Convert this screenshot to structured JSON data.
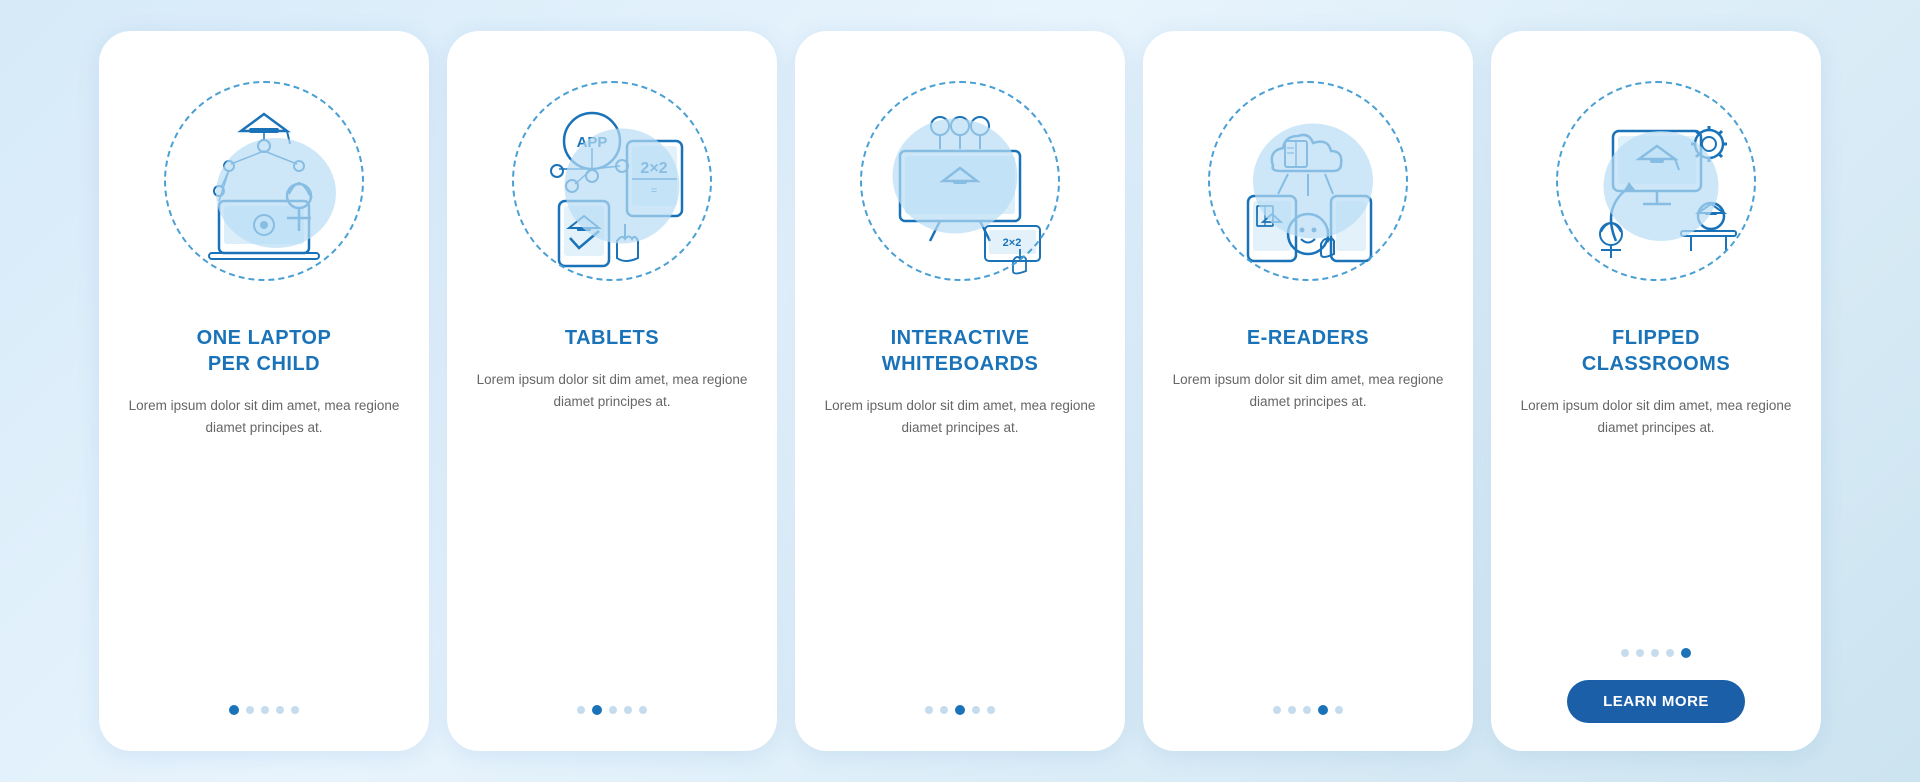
{
  "cards": [
    {
      "id": "laptop-per-child",
      "title": "ONE LAPTOP\nPER CHILD",
      "description": "Lorem ipsum dolor sit dim amet, mea regione diamet principes at.",
      "dots": [
        1,
        2,
        3,
        4,
        5
      ],
      "active_dot": 1,
      "has_button": false,
      "button_label": ""
    },
    {
      "id": "tablets",
      "title": "TABLETS",
      "description": "Lorem ipsum dolor sit dim amet, mea regione diamet principes at.",
      "dots": [
        1,
        2,
        3,
        4,
        5
      ],
      "active_dot": 2,
      "has_button": false,
      "button_label": ""
    },
    {
      "id": "interactive-whiteboards",
      "title": "INTERACTIVE\nWHITEBOARDS",
      "description": "Lorem ipsum dolor sit dim amet, mea regione diamet principes at.",
      "dots": [
        1,
        2,
        3,
        4,
        5
      ],
      "active_dot": 3,
      "has_button": false,
      "button_label": ""
    },
    {
      "id": "e-readers",
      "title": "E-READERS",
      "description": "Lorem ipsum dolor sit dim amet, mea regione diamet principes at.",
      "dots": [
        1,
        2,
        3,
        4,
        5
      ],
      "active_dot": 4,
      "has_button": false,
      "button_label": ""
    },
    {
      "id": "flipped-classrooms",
      "title": "FLIPPED\nCLASSROOMS",
      "description": "Lorem ipsum dolor sit dim amet, mea regione diamet principes at.",
      "dots": [
        1,
        2,
        3,
        4,
        5
      ],
      "active_dot": 5,
      "has_button": true,
      "button_label": "LEARN MORE"
    }
  ],
  "colors": {
    "primary": "#1a73b8",
    "accent": "#4a9fd4",
    "light_blue": "#b8ddf5",
    "text_secondary": "#666666",
    "button_bg": "#1a5fa8",
    "dot_inactive": "#c5dcef"
  }
}
